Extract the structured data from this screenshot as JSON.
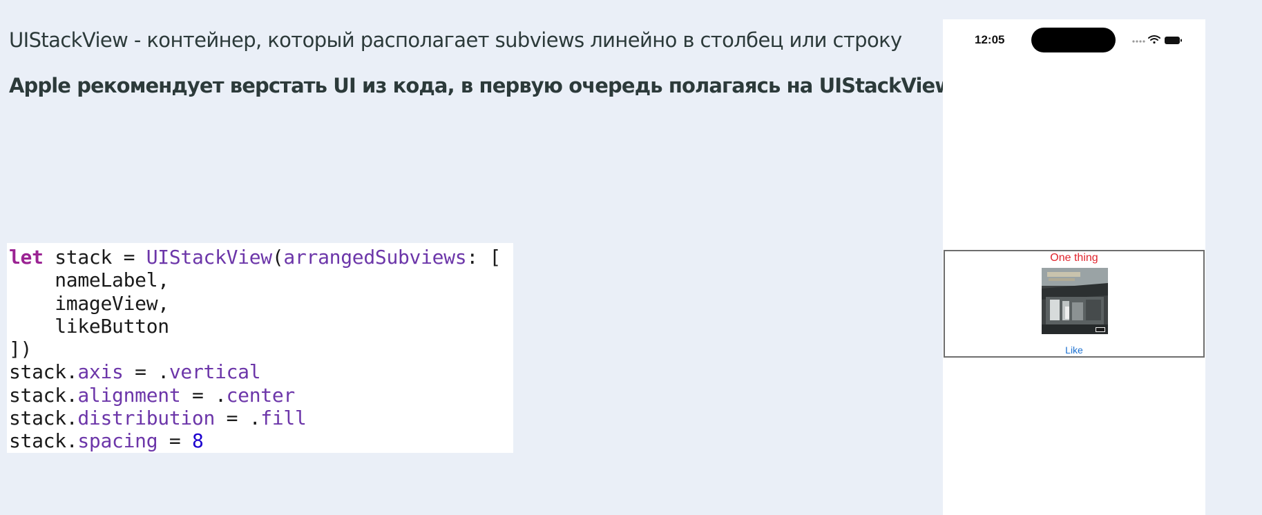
{
  "slide": {
    "heading1": "UIStackView - контейнер, который располагает subviews линейно в столбец или строку",
    "heading2": "Apple рекомендует верстать UI из кода, в первую очередь полагаясь на UIStackView"
  },
  "code": {
    "lines": [
      "let stack = UIStackView(arrangedSubviews: [",
      "    nameLabel,",
      "    imageView,",
      "    likeButton",
      "])",
      "stack.axis = .vertical",
      "stack.alignment = .center",
      "stack.distribution = .fill",
      "stack.spacing = 8"
    ]
  },
  "phone": {
    "time": "12:05",
    "status_icons": [
      "signal-dots-icon",
      "wifi-icon",
      "battery-icon"
    ],
    "stack": {
      "name_label": "One thing",
      "image": "album-cover-image",
      "like_button": "Like"
    }
  },
  "colors": {
    "background": "#eaeff7",
    "keyword": "#9b2393",
    "type": "#6c36a9",
    "number": "#1c00cf",
    "name_label": "#e0242c",
    "like_button": "#1a6fd0"
  }
}
